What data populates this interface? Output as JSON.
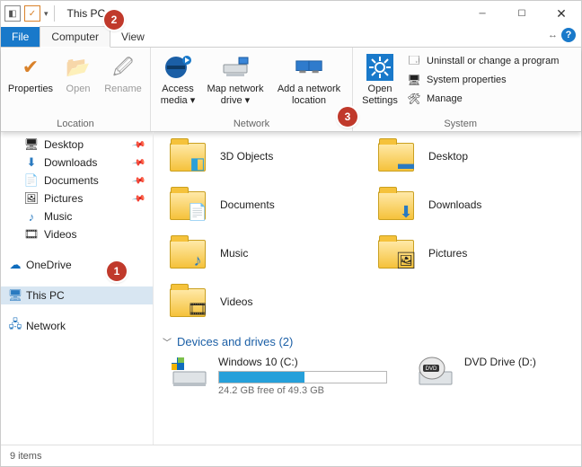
{
  "window": {
    "title": "This PC"
  },
  "tabs": {
    "file": "File",
    "computer": "Computer",
    "view": "View"
  },
  "ribbon": {
    "location": {
      "label": "Location",
      "properties": "Properties",
      "open": "Open",
      "rename": "Rename"
    },
    "network": {
      "label": "Network",
      "access_media": "Access media ▾",
      "map_drive": "Map network drive ▾",
      "add_location": "Add a network location"
    },
    "system": {
      "label": "System",
      "open_settings": "Open Settings",
      "uninstall": "Uninstall or change a program",
      "sys_props": "System properties",
      "manage": "Manage"
    }
  },
  "nav": {
    "desktop": "Desktop",
    "downloads": "Downloads",
    "documents": "Documents",
    "pictures": "Pictures",
    "music": "Music",
    "videos": "Videos",
    "onedrive": "OneDrive",
    "this_pc": "This PC",
    "network": "Network"
  },
  "folders": {
    "3d": "3D Objects",
    "desktop": "Desktop",
    "documents": "Documents",
    "downloads": "Downloads",
    "music": "Music",
    "pictures": "Pictures",
    "videos": "Videos"
  },
  "devices": {
    "header": "Devices and drives (2)",
    "c": {
      "label": "Windows 10 (C:)",
      "free_text": "24.2 GB free of 49.3 GB",
      "fill_percent": 51
    },
    "d": {
      "label": "DVD Drive (D:)"
    }
  },
  "status": {
    "items": "9 items"
  },
  "markers": {
    "m1": "1",
    "m2": "2",
    "m3": "3"
  }
}
